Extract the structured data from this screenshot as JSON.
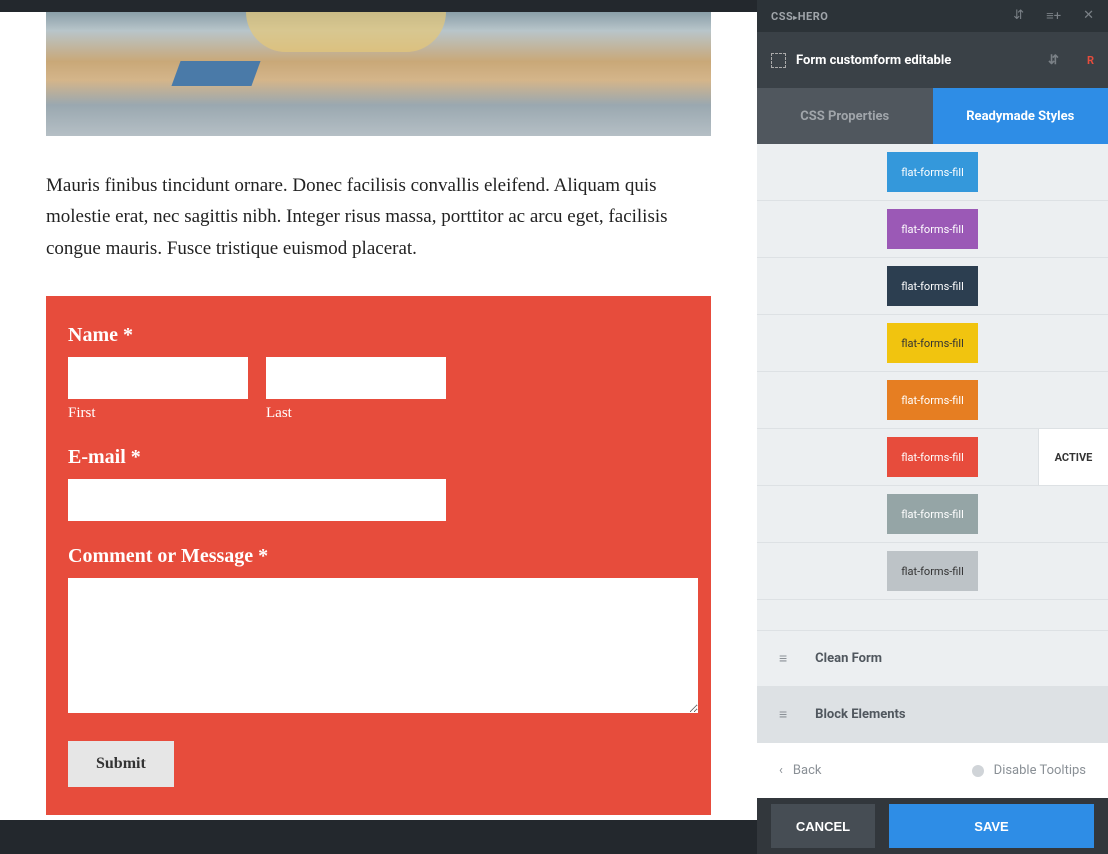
{
  "content": {
    "body_text": "Mauris finibus tincidunt ornare. Donec facilisis convallis eleifend. Aliquam quis molestie erat, nec sagittis nibh. Integer risus massa, porttitor ac arcu eget, facilisis congue mauris. Fusce tristique euismod placerat.",
    "form": {
      "name_label": "Name ",
      "first_sub": "First",
      "last_sub": "Last",
      "email_label": "E-mail ",
      "message_label": "Comment or Message ",
      "required": "*",
      "submit": "Submit"
    }
  },
  "panel": {
    "brand_left": "CSS",
    "brand_right": "HERO",
    "selection": "Form customform editable",
    "tabs": {
      "css": "CSS Properties",
      "ready": "Readymade Styles"
    },
    "styles": [
      {
        "label": "flat-forms-fill",
        "bg": "#3498db",
        "dark": false,
        "active": false
      },
      {
        "label": "flat-forms-fill",
        "bg": "#9b59b6",
        "dark": false,
        "active": false
      },
      {
        "label": "flat-forms-fill",
        "bg": "#2c3e50",
        "dark": false,
        "active": false
      },
      {
        "label": "flat-forms-fill",
        "bg": "#f1c40f",
        "dark": true,
        "active": false
      },
      {
        "label": "flat-forms-fill",
        "bg": "#e67e22",
        "dark": false,
        "active": false
      },
      {
        "label": "flat-forms-fill",
        "bg": "#e74c3c",
        "dark": false,
        "active": true
      },
      {
        "label": "flat-forms-fill",
        "bg": "#95a5a6",
        "dark": false,
        "active": false
      },
      {
        "label": "flat-forms-fill",
        "bg": "#bdc3c7",
        "dark": true,
        "active": false
      }
    ],
    "active_label": "ACTIVE",
    "sections": {
      "clean": "Clean Form",
      "block": "Block Elements"
    },
    "footer": {
      "back": "Back",
      "disable": "Disable Tooltips"
    },
    "actions": {
      "cancel": "CANCEL",
      "save": "SAVE"
    },
    "r_badge": "R"
  }
}
